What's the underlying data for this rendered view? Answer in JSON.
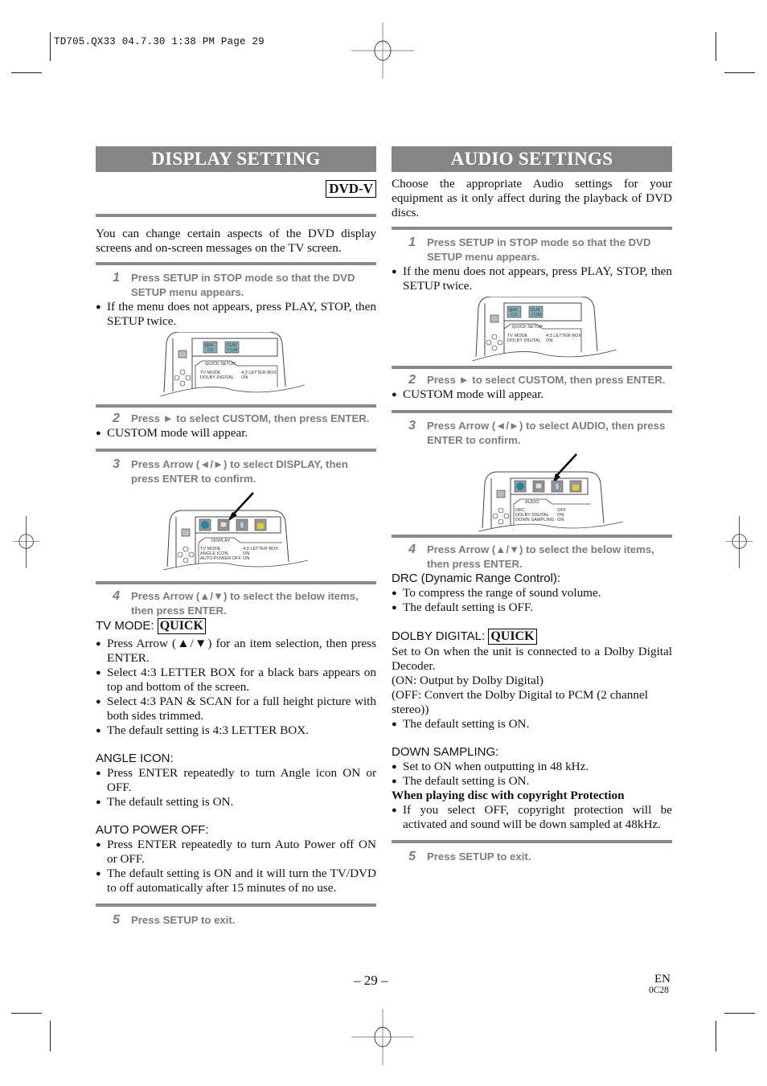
{
  "print_slug": "TD705.QX33   04.7.30   1:38 PM   Page 29",
  "display_setting": {
    "title": "DISPLAY SETTING",
    "badge": "DVD-V",
    "intro": "You can change certain aspects of the DVD display screens and on-screen messages on the TV screen.",
    "steps": [
      {
        "num": "1",
        "text": "Press SETUP in STOP mode so that the DVD SETUP menu appears.",
        "bullets": [
          "If the menu does not appears, press PLAY, STOP, then SETUP twice."
        ]
      },
      {
        "num": "2",
        "text": "Press ► to select CUSTOM, then press ENTER.",
        "bullets": [
          "CUSTOM mode will appear."
        ]
      },
      {
        "num": "3",
        "text": "Press Arrow (◄/►) to select DISPLAY, then press ENTER to confirm."
      },
      {
        "num": "4",
        "text": "Press Arrow (▲/▼) to select the below items, then press ENTER."
      },
      {
        "num": "5",
        "text": "Press SETUP to exit."
      }
    ],
    "screen1": {
      "tab": "QUICK SETUP",
      "btn1": [
        "QUI",
        "CK"
      ],
      "btn2": [
        "CUS",
        "TOM"
      ],
      "rows": [
        [
          "TV MODE",
          "4:3 LETTER BOX"
        ],
        [
          "DOLBY DIGITAL",
          "ON"
        ]
      ]
    },
    "screen2": {
      "tab": "DISPLAY",
      "rows": [
        [
          "TV MODE",
          "4:3 LETTER BOX"
        ],
        [
          "ANGLE ICON",
          "ON"
        ],
        [
          "AUTO POWER OFF",
          "ON"
        ]
      ]
    },
    "items": [
      {
        "heading": "TV MODE:",
        "quick": "QUICK",
        "bullets": [
          "Press Arrow (▲/▼) for an item selection, then press ENTER.",
          "Select 4:3 LETTER BOX for a black bars appears on top and bottom of the screen.",
          "Select 4:3 PAN & SCAN for a full height picture with both sides trimmed.",
          "The default setting is 4:3 LETTER BOX."
        ]
      },
      {
        "heading": "ANGLE ICON:",
        "bullets": [
          "Press ENTER repeatedly to turn Angle icon ON or OFF.",
          "The default setting is ON."
        ]
      },
      {
        "heading": "AUTO POWER OFF:",
        "bullets": [
          "Press ENTER repeatedly to turn Auto Power off ON or OFF.",
          "The default setting is ON and it will turn the TV/DVD to off automatically after 15 minutes of no use."
        ]
      }
    ]
  },
  "audio_settings": {
    "title": "AUDIO SETTINGS",
    "intro": "Choose the appropriate Audio settings for your equipment as it only affect during the playback of DVD discs.",
    "steps": [
      {
        "num": "1",
        "text": "Press SETUP in STOP mode so that the DVD SETUP menu appears.",
        "bullets": [
          "If the menu does not appears, press PLAY, STOP, then SETUP twice."
        ]
      },
      {
        "num": "2",
        "text": "Press ► to select CUSTOM, then press ENTER.",
        "bullets": [
          "CUSTOM mode will appear."
        ]
      },
      {
        "num": "3",
        "text": "Press Arrow (◄/►) to select AUDIO, then press ENTER to confirm."
      },
      {
        "num": "4",
        "text": "Press Arrow (▲/▼) to select the below items, then press ENTER."
      },
      {
        "num": "5",
        "text": "Press SETUP to exit."
      }
    ],
    "screen1": {
      "tab": "QUICK SETUP",
      "btn1": [
        "QUI",
        "CK"
      ],
      "btn2": [
        "CUS",
        "TOM"
      ],
      "rows": [
        [
          "TV MODE",
          "4:3 LETTER BOX"
        ],
        [
          "DOLBY DIGITAL",
          "ON"
        ]
      ]
    },
    "screen2": {
      "tab": "AUDIO",
      "rows": [
        [
          "DRC",
          "OFF"
        ],
        [
          "DOLBY DIGITAL",
          "ON"
        ],
        [
          "DOWN SAMPLING",
          "ON"
        ]
      ]
    },
    "drc": {
      "heading": "DRC (Dynamic Range Control):",
      "bullets": [
        "To compress the range of sound volume.",
        "The default setting is OFF."
      ]
    },
    "dolby": {
      "heading": "DOLBY DIGITAL:",
      "quick": "QUICK",
      "lines": [
        "Set to On when the unit is connected to a Dolby Digital Decoder.",
        "(ON: Output by Dolby Digital)",
        "(OFF: Convert the Dolby Digital to PCM (2 channel stereo))"
      ],
      "bullets": [
        "The default setting is ON."
      ]
    },
    "down": {
      "heading": "DOWN SAMPLING:",
      "bullets": [
        "Set to ON when outputting in 48 kHz.",
        "The default setting is ON."
      ],
      "subheading": "When playing disc with copyright Protection",
      "sub_bullets": [
        "If you select OFF, copyright protection will be activated and sound will be down sampled at 48kHz."
      ]
    }
  },
  "footer": {
    "page": "– 29 –",
    "lang": "EN",
    "code": "0C28"
  }
}
